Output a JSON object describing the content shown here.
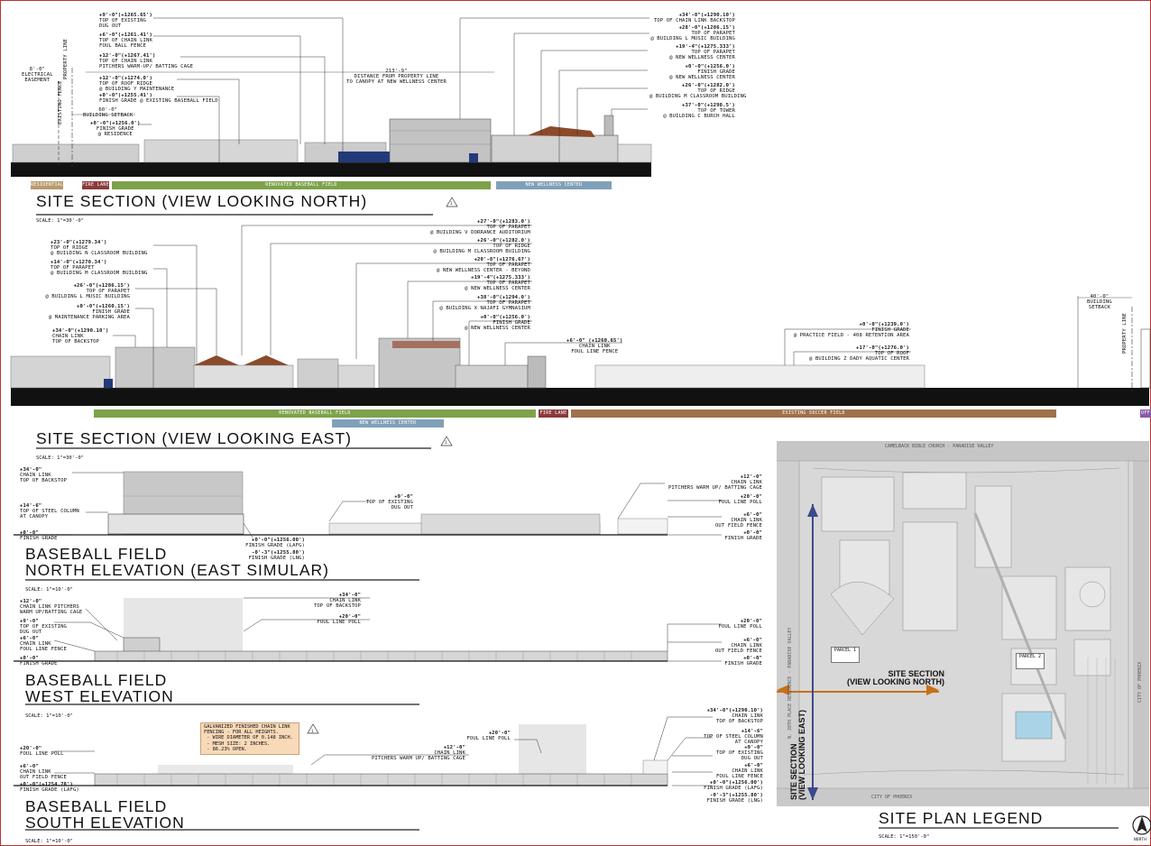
{
  "section_north": {
    "title": "SITE SECTION (VIEW LOOKING NORTH)",
    "scale": "SCALE:   1\"=30'-0\"",
    "revision": "1",
    "left_labels": [
      {
        "elev": "+9'-0\"(+1265.65')",
        "text": "TOP OF EXISTING\nDUG OUT"
      },
      {
        "elev": "+6'-0\"(+1261.41')",
        "text": "TOP OF CHAIN LINK\nFOUL BALL FENCE"
      },
      {
        "elev": "+12'-0\"(+1267.41')",
        "text": "TOP OF CHAIN LINK\nPITCHERS WARM-UP/ BATTING CAGE"
      },
      {
        "elev": "+12'-0\"(+1274.0')",
        "text": "TOP OF ROOF RIDGE\n@ BUILDING Y MAINTENANCE"
      },
      {
        "elev": "+0'-0\"(+1255.41')",
        "text": "FINISH GRADE @ EXISTING BASEBALL FIELD"
      },
      {
        "elev": "+0'-0\"(+1256.0')",
        "text": "FINISH GRADE\n@ RESIDENCE"
      }
    ],
    "dims": [
      {
        "val": "8'-0\"",
        "text": "ELECTRICAL\nEASEMENT"
      },
      {
        "val": "60'-0\"",
        "text": "BUILDING SETBACK"
      },
      {
        "val": "213'-9\"",
        "text": "DISTANCE FROM PROPERTY LINE\nTO CANOPY AT NEW WELLNESS CENTER"
      }
    ],
    "vertical_labels": [
      "PROPERTY LINE",
      "EXISTING FENCE"
    ],
    "right_labels": [
      {
        "elev": "+34'-0\"(+1290.10')",
        "text": "TOP OF CHAIN LINK BACKSTOP"
      },
      {
        "elev": "+28'-0\"(+1286.15')",
        "text": "TOP OF PARAPET\n@ BUILDING L MUSIC BUILDING"
      },
      {
        "elev": "+19'-4\"(+1275.333')",
        "text": "TOP OF PARAPET\n@ NEW WELLNESS CENTER"
      },
      {
        "elev": "+0'-0\"(+1256.0')",
        "text": "FINISH GRADE\n@ NEW WELLNESS CENTER"
      },
      {
        "elev": "+26'-0\"(+1282.0')",
        "text": "TOP OF RIDGE\n@ BUILDING M CLASSROOM BUILDING"
      },
      {
        "elev": "+37'-0\"(+1298.5')",
        "text": "TOP OF TOWER\n@ BUILDING C BURCH HALL"
      }
    ],
    "bands": [
      {
        "label": "RESIDENTIAL",
        "color": "#b89a6a"
      },
      {
        "label": "FIRE LANE",
        "color": "#8b3a3a"
      },
      {
        "label": "RENOVATED BASEBALL FIELD",
        "color": "#7da24a"
      },
      {
        "label": "NEW WELLNESS CENTER",
        "color": "#7fa0b8"
      }
    ]
  },
  "section_east": {
    "title": "SITE SECTION (VIEW LOOKING EAST)",
    "scale": "SCALE:   1\"=30'-0\"",
    "revision": "1",
    "left_labels": [
      {
        "elev": "+23'-0\"(+1279.34')",
        "text": "TOP OF RIDGE\n@ BUILDING N CLASSROOM BUILDING"
      },
      {
        "elev": "+14'-0\"(+1270.34')",
        "text": "TOP OF PARAPET\n@ BUILDING M CLASSROOM BUILDING"
      },
      {
        "elev": "+26'-0\"(+1286.15')",
        "text": "TOP OF PARAPET\n@ BUILDING L MUSIC BUILDING"
      },
      {
        "elev": "+0'-0\"(+1260.15')",
        "text": "FINISH GRADE\n@ MAINTENANCE PARKING AREA"
      },
      {
        "elev": "+34'-0\"(+1290.10')",
        "text": "CHAIN LINK\nTOP OF BACKSTOP"
      }
    ],
    "right_labels": [
      {
        "elev": "+27'-0\"(+1283.0')",
        "text": "TOP OF PARAPET\n@ BUILDING V DORRANCE AUDITORIUM"
      },
      {
        "elev": "+26'-0\"(+1282.0')",
        "text": "TOP OF RIDGE\n@ BUILDING M CLASSROOM BUILDING"
      },
      {
        "elev": "+20'-8\"(+1276.67')",
        "text": "TOP OF PARAPET\n@ NEW WELLNESS CENTER - BEYOND"
      },
      {
        "elev": "+19'-4\"(+1275.333')",
        "text": "TOP OF PARAPET\n@ NEW WELLNESS CENTER"
      },
      {
        "elev": "+38'-0\"(+1294.0')",
        "text": "TOP OF PARAPET\n@ BUILDING X NAJAFI GYMNASIUM"
      },
      {
        "elev": "+0'-0\"(+1256.0')",
        "text": "FINISH GRADE\n@ NEW WELLNESS CENTER"
      },
      {
        "elev": "+6'-0\" (+1260.65')",
        "text": "CHAIN LINK\nFOUL LINE FENCE"
      },
      {
        "elev": "+0'-0\"(+1239.0')",
        "text": "FINISH GRADE\n@ PRACTICE FIELD - 408 RETENTION AREA"
      },
      {
        "elev": "+17'-0\"(+1276.0')",
        "text": "TOP OF ROOF\n@ BUILDING Z DADY AQUATIC CENTER"
      }
    ],
    "setback": {
      "val": "40'-0\"",
      "text": "BUILDING\nSETBACK"
    },
    "property_line": "PROPERTY LINE",
    "bands": [
      {
        "label": "RENOVATED BASEBALL FIELD",
        "color": "#7da24a"
      },
      {
        "label": "NEW WELLNESS CENTER",
        "color": "#7fa0b8"
      },
      {
        "label": "FIRE LANE",
        "color": "#8b3a3a"
      },
      {
        "label": "EXISTING SOCCER FIELD",
        "color": "#a0704a"
      },
      {
        "label": "OFF",
        "color": "#8a5aa8"
      }
    ]
  },
  "north_elev": {
    "title1": "BASEBALL FIELD",
    "title2": "NORTH ELEVATION (EAST SIMULAR)",
    "scale": "SCALE:   1\"=10'-0\"",
    "left_labels": [
      {
        "elev": "+34'-0\"",
        "text": "CHAIN LINK\nTOP OF BACKSTOP"
      },
      {
        "elev": "+14'-6\"",
        "text": "TOP OF STEEL COLUMN\nAT CANOPY"
      },
      {
        "elev": "+0'-0\"",
        "text": "FINISH GRADE"
      }
    ],
    "mid_labels": [
      {
        "elev": "+9'-0\"",
        "text": "TOP OF EXISTING\nDUG OUT"
      },
      {
        "elev": "+0'-0\"(+1256.00')",
        "text": "FINISH GRADE (LAFG)"
      },
      {
        "elev": "-0'-3\"(+1255.80')",
        "text": "FINISH GRADE (LNG)"
      }
    ],
    "right_labels": [
      {
        "elev": "+12'-0\"",
        "text": "CHAIN LINK\nPITCHERS WARM UP/ BATTING CAGE"
      },
      {
        "elev": "+20'-0\"",
        "text": "FOUL LINE POLL"
      },
      {
        "elev": "+6'-0\"",
        "text": "CHAIN LINK\nOUT FIELD FENCE"
      },
      {
        "elev": "+0'-0\"",
        "text": "FINISH GRADE"
      }
    ]
  },
  "west_elev": {
    "title1": "BASEBALL FIELD",
    "title2": "WEST ELEVATION",
    "scale": "SCALE:   1\"=10'-0\"",
    "left_labels": [
      {
        "elev": "+12'-0\"",
        "text": "CHAIN LINK PITCHERS\nWARM UP/BATTING CAGE"
      },
      {
        "elev": "+9'-0\"",
        "text": "TOP OF EXISTING\nDUG OUT"
      },
      {
        "elev": "+6'-0\"",
        "text": "CHAIN LINK\nFOUL LINE FENCE"
      },
      {
        "elev": "+0'-0\"",
        "text": "FINISH GRADE"
      }
    ],
    "mid_labels": [
      {
        "elev": "+34'-0\"",
        "text": "CHAIN LINK\nTOP OF BACKSTOP"
      },
      {
        "elev": "+20'-0\"",
        "text": "FOUL LINE POLL"
      }
    ],
    "right_labels": [
      {
        "elev": "+20'-0\"",
        "text": "FOUL LINE POLL"
      },
      {
        "elev": "+6'-0\"",
        "text": "CHAIN LINK\nOUT FIELD FENCE"
      },
      {
        "elev": "+0'-0\"",
        "text": "FINISH GRADE"
      }
    ]
  },
  "south_elev": {
    "title1": "BASEBALL FIELD",
    "title2": "SOUTH ELEVATION",
    "scale": "SCALE:   1\"=10'-0\"",
    "note": "GALVANIZED FINISHED CHAIN LINK\nFENCING - FOR ALL HEIGHTS.\n - WIRE DIAMETER OF 0.148 INCH.\n - MESH SIZE: 2 INCHES.\n - 86.23% OPEN.",
    "revision": "1",
    "left_labels": [
      {
        "elev": "+20'-0\"",
        "text": "FOUL LINE POLL"
      },
      {
        "elev": "+6'-0\"",
        "text": "CHAIN LINK\nOUT FIELD FENCE"
      },
      {
        "elev": "+0'-0\"(+1254.78')",
        "text": "FINISH GRADE (LAFG)"
      }
    ],
    "mid_labels": [
      {
        "elev": "+12'-0\"",
        "text": "CHAIN LINK\nPITCHERS WARM UP/ BATTING CAGE"
      },
      {
        "elev": "+20'-0\"",
        "text": "FOUL LINE POLL"
      }
    ],
    "right_labels": [
      {
        "elev": "+34'-0\"(+1290.10')",
        "text": "CHAIN LINK\nTOP OF BACKSTOP"
      },
      {
        "elev": "+14'-6\"",
        "text": "TOP OF STEEL COLUMN\nAT CANOPY"
      },
      {
        "elev": "+9'-0\"",
        "text": "TOP OF EXISTING\nDUG OUT"
      },
      {
        "elev": "+6'-0\"",
        "text": "CHAIN LINK\nFOUL LINE FENCE"
      },
      {
        "elev": "+0'-0\"(+1256.00')",
        "text": "FINISH GRADE (LAFG)"
      },
      {
        "elev": "-0'-3\"(+1255.80')",
        "text": "FINISH GRADE (LNG)"
      }
    ]
  },
  "site_plan": {
    "title": "SITE PLAN LEGEND",
    "scale": "SCALE:   1\"=150'-0\"",
    "north": "NORTH",
    "top_label": "CAMELBACK BIBLE CHURCH - PARADISE VALLEY",
    "bottom_label": "CITY OF PHOENIX",
    "left_vertical": "N. 28TH PLACE RESIDENCE - PARADISE VALLEY",
    "right_vertical": "CITY OF PHOENIX",
    "parcel1": "PARCEL 1",
    "parcel2": "PARCEL 2",
    "section_north_label": "SITE SECTION\n(VIEW LOOKING NORTH)",
    "section_east_label": "SITE SECTION\n(VIEW LOOKING EAST)",
    "section_north_color": "#c8701a",
    "section_east_color": "#3a4a8a"
  }
}
